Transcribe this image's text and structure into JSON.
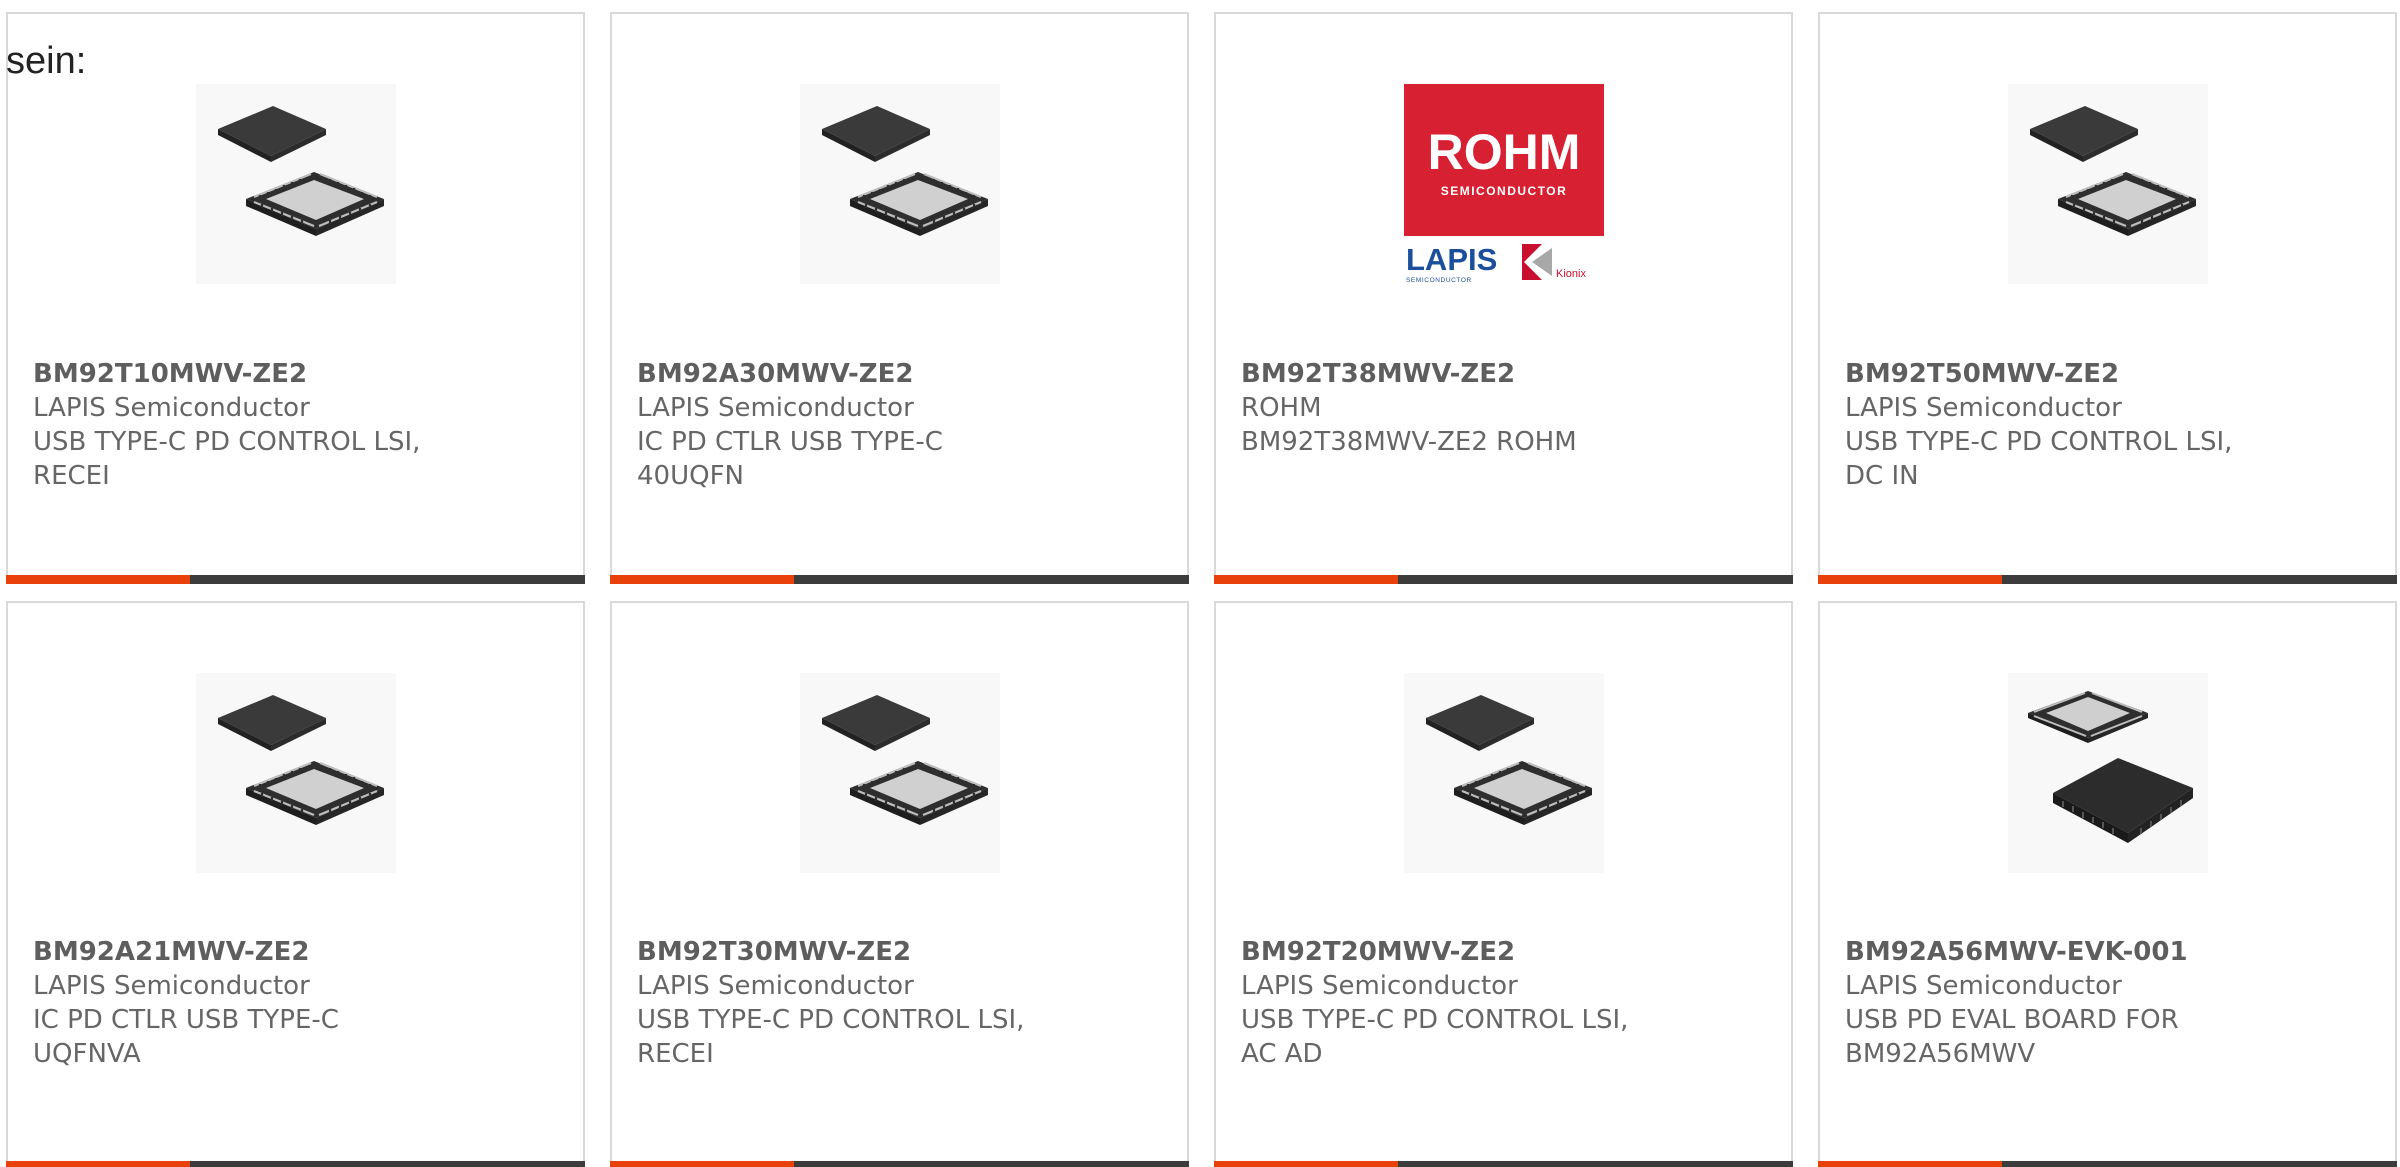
{
  "intro_text": "sein:",
  "colors": {
    "accent": "#e8420a",
    "bar": "#3c3c3c",
    "border": "#d9d9d9",
    "rohm_red": "#d72031",
    "lapis_blue": "#1a4f9c"
  },
  "products": [
    {
      "part_number": "BM92T10MWV-ZE2",
      "manufacturer": "LAPIS Semiconductor",
      "description": "USB TYPE-C PD CONTROL LSI, RECEI",
      "image": "qfn-chip-icon"
    },
    {
      "part_number": "BM92A30MWV-ZE2",
      "manufacturer": "LAPIS Semiconductor",
      "description": "IC PD CTLR USB TYPE-C 40UQFN",
      "image": "qfn-chip-icon"
    },
    {
      "part_number": "BM92T38MWV-ZE2",
      "manufacturer": "ROHM",
      "description": "BM92T38MWV-ZE2 ROHM",
      "image": "rohm-logo",
      "logo_text": {
        "rohm": "ROHM",
        "semiconductor": "SEMICONDUCTOR",
        "lapis": "LAPIS",
        "lapis_sub": "SEMICONDUCTOR",
        "kionix": "Kionix"
      }
    },
    {
      "part_number": "BM92T50MWV-ZE2",
      "manufacturer": "LAPIS Semiconductor",
      "description": "USB TYPE-C PD CONTROL LSI, DC IN",
      "image": "qfn-chip-icon"
    },
    {
      "part_number": "BM92A21MWV-ZE2",
      "manufacturer": "LAPIS Semiconductor",
      "description": "IC PD CTLR USB TYPE-C UQFNVA",
      "image": "qfn-chip-icon"
    },
    {
      "part_number": "BM92T30MWV-ZE2",
      "manufacturer": "LAPIS Semiconductor",
      "description": "USB TYPE-C PD CONTROL LSI, RECEI",
      "image": "qfn-chip-icon"
    },
    {
      "part_number": "BM92T20MWV-ZE2",
      "manufacturer": "LAPIS Semiconductor",
      "description": "USB TYPE-C PD CONTROL LSI, AC AD",
      "image": "qfn-chip-icon"
    },
    {
      "part_number": "BM92A56MWV-EVK-001",
      "manufacturer": "LAPIS Semiconductor",
      "description": "USB PD EVAL BOARD FOR BM92A56MWV",
      "image": "eval-chip-icon"
    }
  ]
}
